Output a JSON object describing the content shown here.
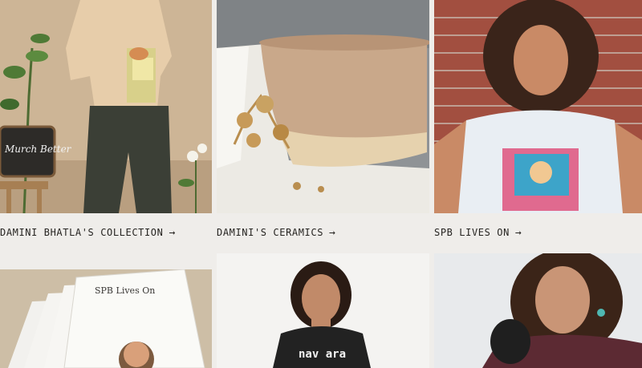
{
  "collections": [
    {
      "title": "DAMINI BHATLA'S COLLECTION",
      "image_sign_text": "Murch Better"
    },
    {
      "title": "DAMINI'S CERAMICS"
    },
    {
      "title": "SPB LIVES ON"
    }
  ],
  "second_row": [
    {
      "book_text": "SPB Lives On"
    },
    {
      "shirt_text": "nav ara"
    },
    {}
  ],
  "colors": {
    "background": "#efedea",
    "caption_text": "#262421"
  },
  "icons": {
    "arrow": "→"
  }
}
